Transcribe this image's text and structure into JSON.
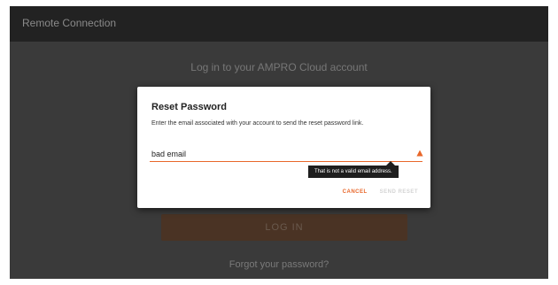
{
  "window": {
    "title": "Remote Connection"
  },
  "login": {
    "heading": "Log in to your AMPRO Cloud account",
    "button_label": "LOG IN",
    "forgot_link": "Forgot your password?"
  },
  "dialog": {
    "title": "Reset Password",
    "body": "Enter the email associated with your account to send the reset password link.",
    "email_value": "bad email",
    "error_message": "That is not a valid email address.",
    "cancel_label": "CANCEL",
    "submit_label": "SEND RESET",
    "accent_color": "#e8672a",
    "error_icon": "warning-icon"
  }
}
